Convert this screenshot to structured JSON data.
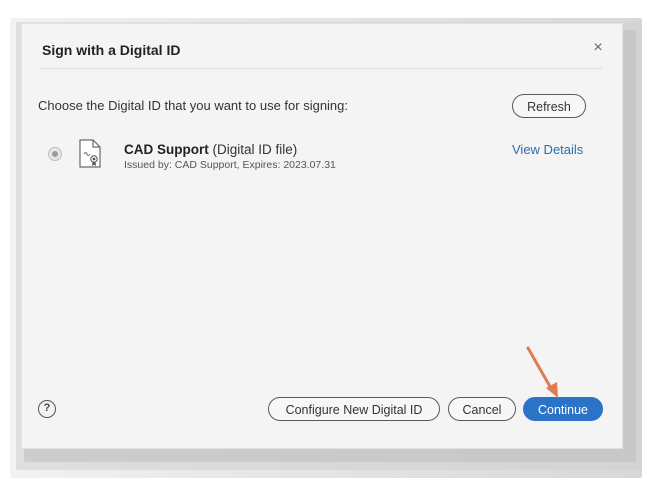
{
  "dialog": {
    "title": "Sign with a Digital ID",
    "close_label": "×",
    "prompt": "Choose the Digital ID that you want to use for signing:",
    "refresh_label": "Refresh",
    "digital_ids": [
      {
        "name": "CAD Support",
        "type": " (Digital ID file)",
        "issued": "Issued by: CAD Support, Expires: 2023.07.31",
        "selected": true,
        "details_link": "View Details"
      }
    ],
    "help_label": "?",
    "buttons": {
      "configure": "Configure New Digital ID",
      "cancel": "Cancel",
      "continue": "Continue"
    }
  },
  "colors": {
    "primary_button": "#2b73c9",
    "link": "#2b6cb0",
    "annotation_arrow": "#e07b54"
  },
  "icons": {
    "close": "close-icon",
    "certificate": "certificate-file-icon",
    "help": "help-icon",
    "annotation": "arrow-annotation-icon"
  }
}
